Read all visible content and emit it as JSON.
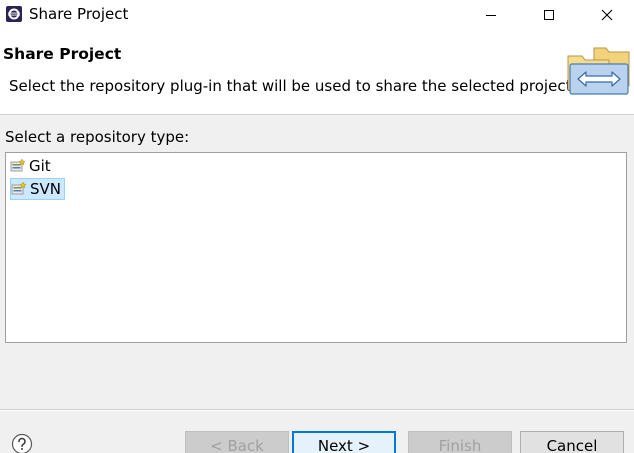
{
  "window": {
    "title": "Share Project",
    "minimize_icon": "minimize-icon",
    "maximize_icon": "maximize-icon",
    "close_icon": "close-icon"
  },
  "header": {
    "title": "Share Project",
    "description": "Select the repository plug-in that will be used to share the selected project."
  },
  "main": {
    "select_label": "Select a repository type:",
    "repository_types": [
      {
        "label": "Git",
        "icon": "git-repository-icon",
        "selected": false
      },
      {
        "label": "SVN",
        "icon": "svn-repository-icon",
        "selected": true
      }
    ]
  },
  "footer": {
    "help_icon": "help-icon",
    "back_label": "< Back",
    "next_label": "Next >",
    "finish_label": "Finish",
    "cancel_label": "Cancel"
  },
  "colors": {
    "selection_bg": "#cce8ff",
    "default_button_border": "#0078d7",
    "disabled_text": "#a0a0a0"
  }
}
